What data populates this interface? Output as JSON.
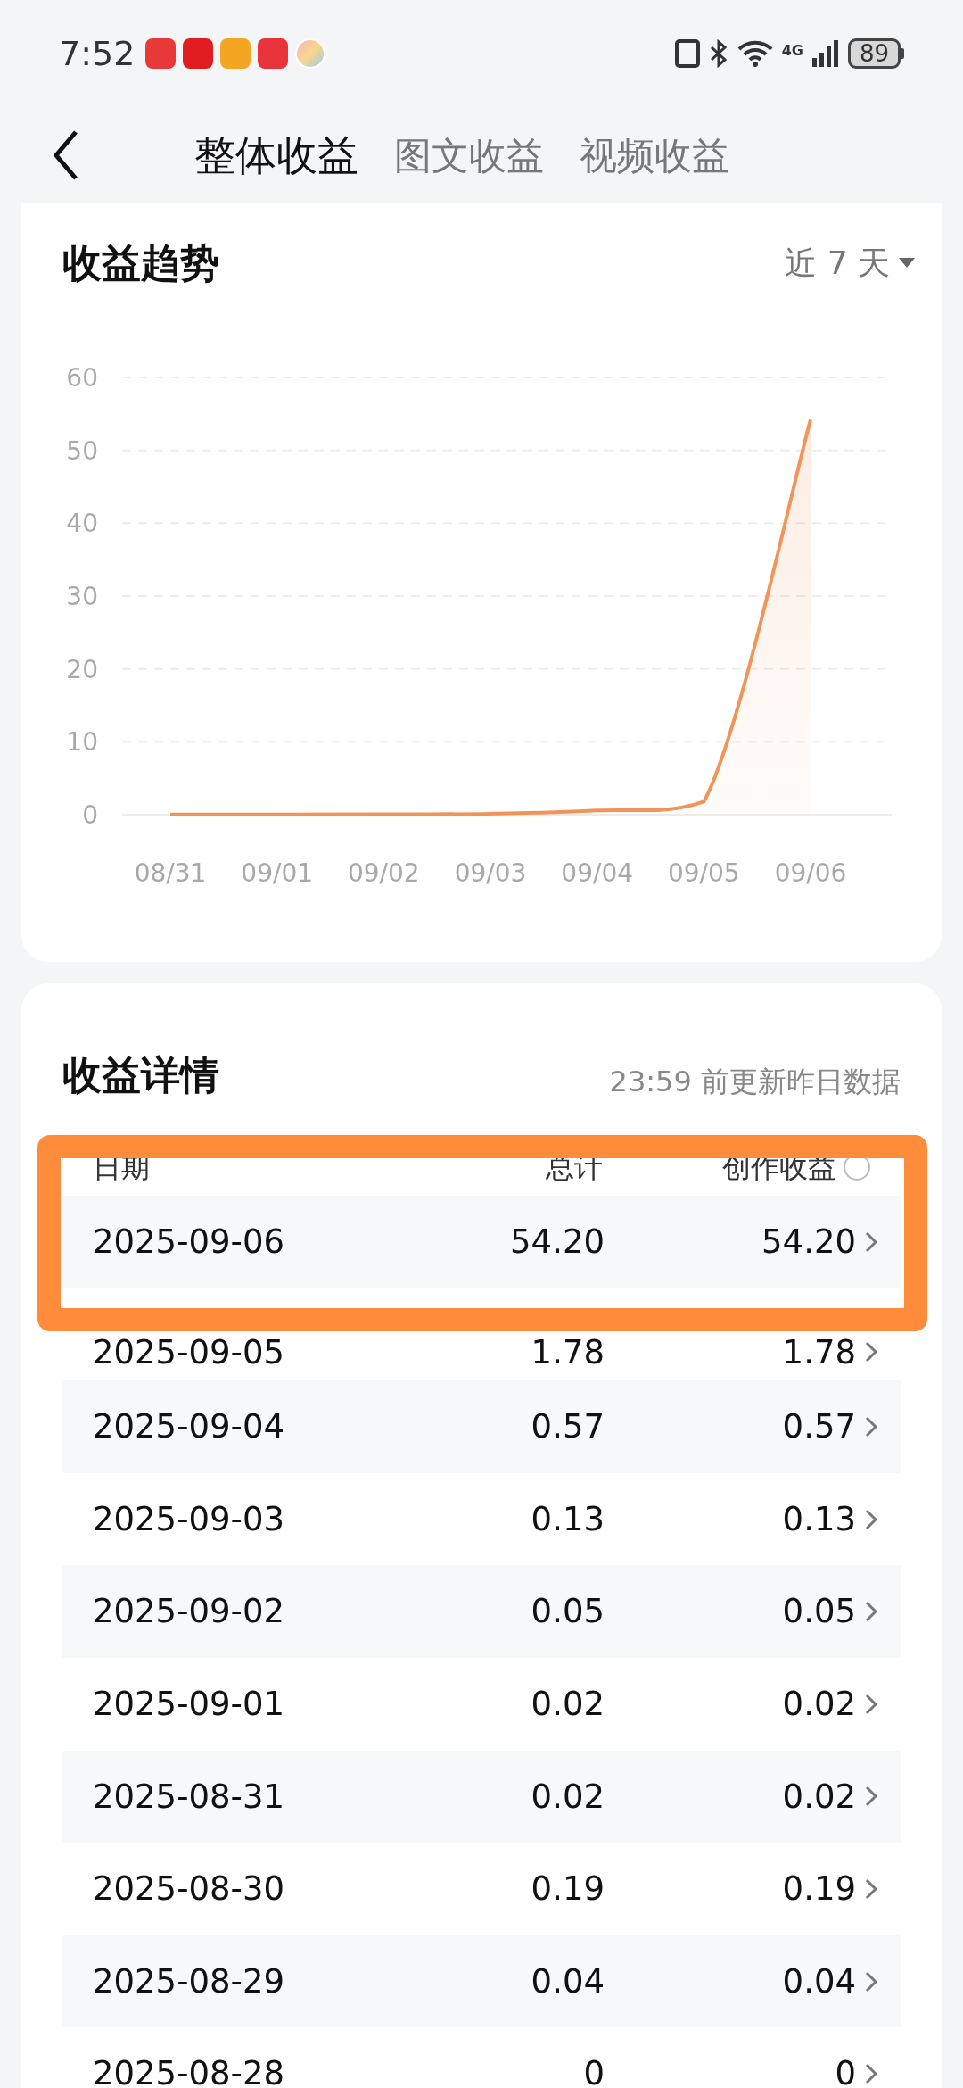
{
  "status_bar": {
    "time": "7:52",
    "network": "4G",
    "battery": "89"
  },
  "tabs": [
    {
      "label": "整体收益",
      "selected": true
    },
    {
      "label": "图文收益",
      "selected": false
    },
    {
      "label": "视频收益",
      "selected": false
    }
  ],
  "trend": {
    "title": "收益趋势",
    "range": "近 7 天",
    "chart_data": {
      "type": "area",
      "categories": [
        "08/31",
        "09/01",
        "09/02",
        "09/03",
        "09/04",
        "09/05",
        "09/06"
      ],
      "series": [
        {
          "color": "#f0955a",
          "values": [
            0.02,
            0.02,
            0.05,
            0.13,
            0.57,
            1.78,
            54.2
          ]
        }
      ],
      "grid": true,
      "ylim": [
        0,
        60
      ],
      "yticks": [
        0,
        10,
        20,
        30,
        40,
        50,
        60
      ]
    }
  },
  "details": {
    "title": "收益详情",
    "note": "23:59 前更新昨日数据",
    "columns": [
      "日期",
      "总计",
      "创作收益"
    ],
    "rows": [
      {
        "date": "2025-09-06",
        "total": "54.20",
        "creation": "54.20"
      },
      {
        "date": "2025-09-05",
        "total": "1.78",
        "creation": "1.78"
      },
      {
        "date": "2025-09-04",
        "total": "0.57",
        "creation": "0.57"
      },
      {
        "date": "2025-09-03",
        "total": "0.13",
        "creation": "0.13"
      },
      {
        "date": "2025-09-02",
        "total": "0.05",
        "creation": "0.05"
      },
      {
        "date": "2025-09-01",
        "total": "0.02",
        "creation": "0.02"
      },
      {
        "date": "2025-08-31",
        "total": "0.02",
        "creation": "0.02"
      },
      {
        "date": "2025-08-30",
        "total": "0.19",
        "creation": "0.19"
      },
      {
        "date": "2025-08-29",
        "total": "0.04",
        "creation": "0.04"
      },
      {
        "date": "2025-08-28",
        "total": "0",
        "creation": "0"
      }
    ]
  }
}
